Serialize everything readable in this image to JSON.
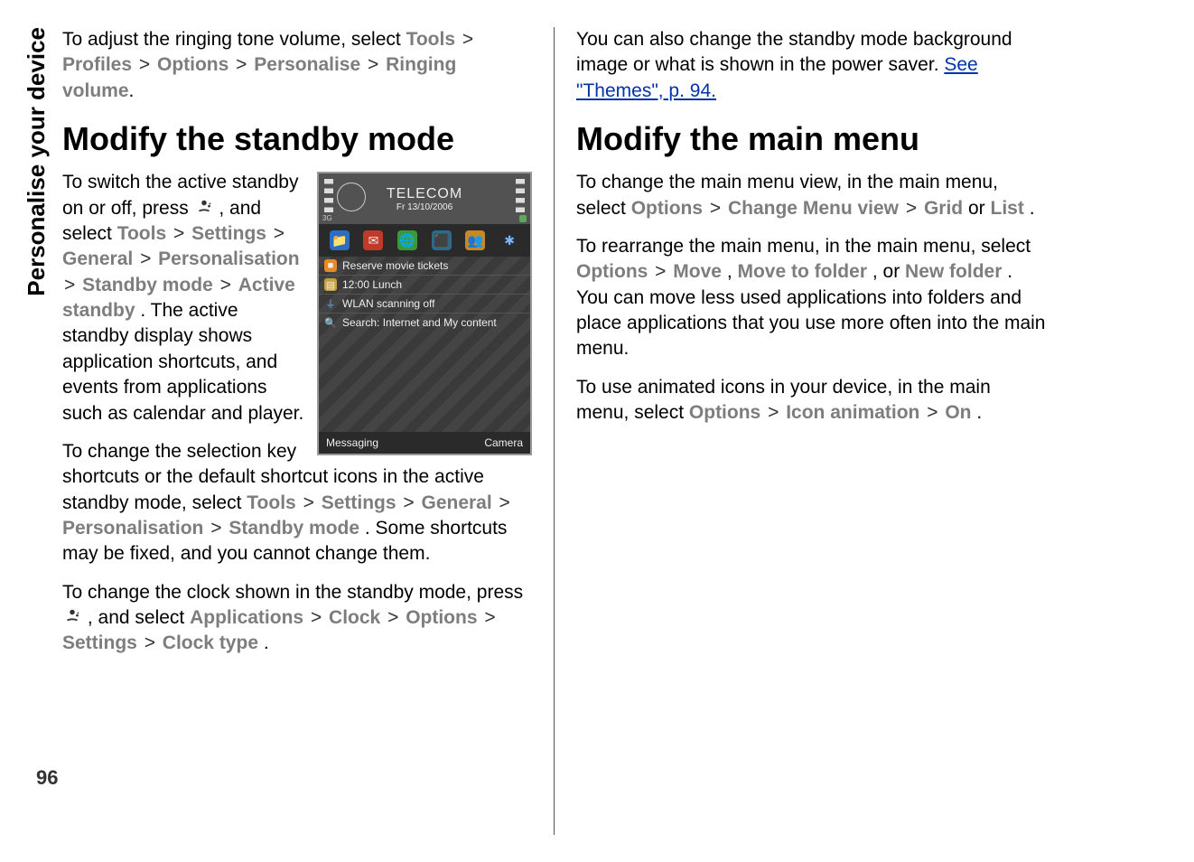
{
  "sidebar_title": "Personalise your device",
  "page_number": "96",
  "col1": {
    "p1_pre": "To adjust the ringing tone volume, select ",
    "p1_items": [
      "Tools",
      "Profiles",
      "Options",
      "Personalise",
      "Ringing volume"
    ],
    "h_standby": "Modify the standby mode",
    "p2_pre": "To switch the active standby on or off, press ",
    "p2_mid1": ", and select ",
    "p2_items": [
      "Tools",
      "Settings",
      "General",
      "Personalisation",
      "Standby mode",
      "Active standby"
    ],
    "p2_post": ".  The active standby display shows application shortcuts, and events from applications such as calendar and player.",
    "p3_pre": "To change the selection key shortcuts or the default shortcut icons in the active standby mode, select ",
    "p3_items": [
      "Tools",
      "Settings",
      "General",
      "Personalisation",
      "Standby mode"
    ],
    "p3_post": ". Some shortcuts may be fixed, and you cannot change them.",
    "p4_pre": "To change the clock shown in the standby mode, press ",
    "p4_mid1": ", and select ",
    "p4_items": [
      "Applications",
      "Clock",
      "Options",
      "Settings",
      "Clock type"
    ],
    "p4_post": "."
  },
  "col2": {
    "p1_pre": "You can also change the standby mode background image or what is shown in the power saver. ",
    "p1_link": "See \"Themes\", p. 94.",
    "h_menu": "Modify the main menu",
    "p2_pre": "To change the main menu view, in the main menu, select ",
    "p2_items": [
      "Options",
      "Change Menu view",
      "Grid"
    ],
    "p2_or": " or ",
    "p2_item_last": "List",
    "p2_post": ".",
    "p3_pre": "To rearrange the main menu, in the main menu, select ",
    "p3_item1": "Options",
    "p3_gt": " > ",
    "p3_item2": "Move",
    "p3_c1": ", ",
    "p3_item3": "Move to folder",
    "p3_c2": ", or ",
    "p3_item4": "New folder",
    "p3_post": ". You can move less used applications into folders and place applications that you use more often into the main menu.",
    "p4_pre": "To use animated icons in your device, in the main menu, select ",
    "p4_items": [
      "Options",
      "Icon animation",
      "On"
    ],
    "p4_post": "."
  },
  "phone": {
    "operator": "TELECOM",
    "date": "Fr 13/10/2006",
    "g3": "3G",
    "rows": [
      "Reserve movie tickets",
      "12:00 Lunch",
      "WLAN scanning off",
      "Search: Internet and My content"
    ],
    "soft_left": "Messaging",
    "soft_right": "Camera",
    "icons": [
      "📁",
      "✉",
      "🌐",
      "⬛",
      "👥",
      "✱"
    ]
  },
  "sep": ">"
}
